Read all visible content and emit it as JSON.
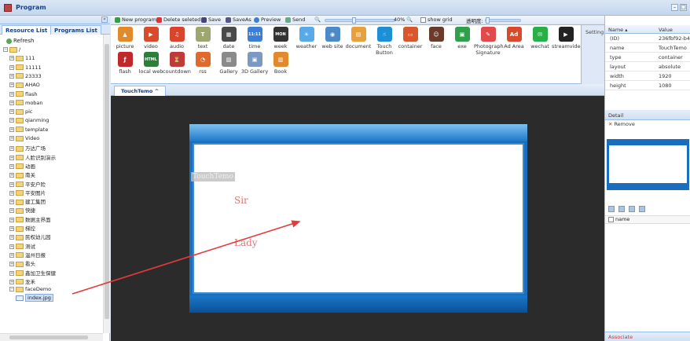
{
  "window": {
    "title": "Program"
  },
  "left": {
    "tabs": [
      "Resource List",
      "Programs List"
    ],
    "refresh": "Refresh",
    "tree": [
      {
        "label": "/",
        "level": 0,
        "type": "root"
      },
      {
        "label": "111",
        "level": 1
      },
      {
        "label": "11111",
        "level": 1
      },
      {
        "label": "23333",
        "level": 1
      },
      {
        "label": "AHAO",
        "level": 1
      },
      {
        "label": "flash",
        "level": 1
      },
      {
        "label": "moban",
        "level": 1
      },
      {
        "label": "pic",
        "level": 1
      },
      {
        "label": "qianming",
        "level": 1
      },
      {
        "label": "template",
        "level": 1
      },
      {
        "label": "Video",
        "level": 1
      },
      {
        "label": "万达广场",
        "level": 1
      },
      {
        "label": "人脸识别演示",
        "level": 1
      },
      {
        "label": "动画",
        "level": 1
      },
      {
        "label": "南关",
        "level": 1
      },
      {
        "label": "平安户险",
        "level": 1
      },
      {
        "label": "平安图片",
        "level": 1
      },
      {
        "label": "建工集团",
        "level": 1
      },
      {
        "label": "快捷",
        "level": 1
      },
      {
        "label": "数据主界面",
        "level": 1
      },
      {
        "label": "梯控",
        "level": 1
      },
      {
        "label": "民权幼儿园",
        "level": 1
      },
      {
        "label": "测试",
        "level": 1
      },
      {
        "label": "温州日报",
        "level": 1
      },
      {
        "label": "看头",
        "level": 1
      },
      {
        "label": "鑫加卫生保健",
        "level": 1
      },
      {
        "label": "龙禾",
        "level": 1
      },
      {
        "label": "faceDemo",
        "level": 1,
        "open": true
      },
      {
        "label": "index.jpg",
        "level": 2,
        "selected": true,
        "file": true
      }
    ]
  },
  "toolbar": {
    "new": "New program",
    "delete": "Delete seleted",
    "save": "Save",
    "saveas": "SaveAs",
    "preview": "Preview",
    "send": "Send",
    "zoom": "40%",
    "zoom_level": 0.4,
    "showgrid": "show grid",
    "opacity_label": "透明度:"
  },
  "palette": {
    "row1": [
      {
        "label": "picture",
        "icon": "picture-icon",
        "color": "#e08a2c",
        "glyph": "▲"
      },
      {
        "label": "video",
        "icon": "video-icon",
        "color": "#d94a2c",
        "glyph": "▶"
      },
      {
        "label": "audio",
        "icon": "audio-icon",
        "color": "#d9442c",
        "glyph": "♫"
      },
      {
        "label": "text",
        "icon": "text-icon",
        "color": "#9ca66e",
        "glyph": "T"
      },
      {
        "label": "date",
        "icon": "date-icon",
        "color": "#4a4a4a",
        "glyph": "▦"
      },
      {
        "label": "time",
        "icon": "time-icon",
        "color": "#3a7ed6",
        "glyph": "11:11"
      },
      {
        "label": "week",
        "icon": "week-icon",
        "color": "#333333",
        "glyph": "MON"
      },
      {
        "label": "weather",
        "icon": "weather-icon",
        "color": "#57a9e8",
        "glyph": "☀"
      },
      {
        "label": "web site",
        "icon": "website-icon",
        "color": "#4d89c9",
        "glyph": "◉"
      },
      {
        "label": "document",
        "icon": "document-icon",
        "color": "#e7a03b",
        "glyph": "▤"
      },
      {
        "label": "Touch Button",
        "icon": "touch-button-icon",
        "color": "#1c8fd6",
        "glyph": "☝"
      },
      {
        "label": "container",
        "icon": "container-icon",
        "color": "#d8572c",
        "glyph": "▭"
      },
      {
        "label": "face",
        "icon": "face-icon",
        "color": "#6a3a2a",
        "glyph": "☺"
      },
      {
        "label": "exe",
        "icon": "exe-icon",
        "color": "#2ea04a",
        "glyph": "▣"
      },
      {
        "label": "Photograph Signature",
        "icon": "photograph-signature-icon",
        "color": "#e04a4a",
        "glyph": "✎"
      },
      {
        "label": "Ad Area",
        "icon": "ad-area-icon",
        "color": "#d84a2c",
        "glyph": "Ad"
      },
      {
        "label": "wechat",
        "icon": "wechat-icon",
        "color": "#2aae47",
        "glyph": "✉"
      },
      {
        "label": "streamvideo",
        "icon": "streamvideo-icon",
        "color": "#222222",
        "glyph": "▶"
      }
    ],
    "row2": [
      {
        "label": "flash",
        "icon": "flash-icon",
        "color": "#c0282c",
        "glyph": "ƒ"
      },
      {
        "label": "local web",
        "icon": "local-web-icon",
        "color": "#2e7d3a",
        "glyph": "HTML"
      },
      {
        "label": "countdown",
        "icon": "countdown-icon",
        "color": "#c03a3a",
        "glyph": "⏳"
      },
      {
        "label": "rss",
        "icon": "rss-icon",
        "color": "#e06a2c",
        "glyph": "◔"
      },
      {
        "label": "Gallery",
        "icon": "gallery-icon",
        "color": "#8a8a8a",
        "glyph": "▨"
      },
      {
        "label": "3D Gallery",
        "icon": "3d-gallery-icon",
        "color": "#7a9ac4",
        "glyph": "▣"
      },
      {
        "label": "Book",
        "icon": "book-icon",
        "color": "#e08a2c",
        "glyph": "▥"
      }
    ],
    "setting": "Setting"
  },
  "stage": {
    "tab": "TouchTemo",
    "element_label": "TouchTemo",
    "text1": "Sir",
    "text2": "Lady"
  },
  "props": {
    "col_name": "Name ▴",
    "col_value": "Value",
    "rows": [
      {
        "name": "(ID)",
        "value": "236fbf92-b4..."
      },
      {
        "name": "name",
        "value": "TouchTemo"
      },
      {
        "name": "type",
        "value": "container"
      },
      {
        "name": "layout",
        "value": "absolute"
      },
      {
        "name": "width",
        "value": "1920"
      },
      {
        "name": "height",
        "value": "1080"
      }
    ],
    "detail": "Detail",
    "remove": "Remove",
    "name_col": "name",
    "associate": "Associate"
  }
}
